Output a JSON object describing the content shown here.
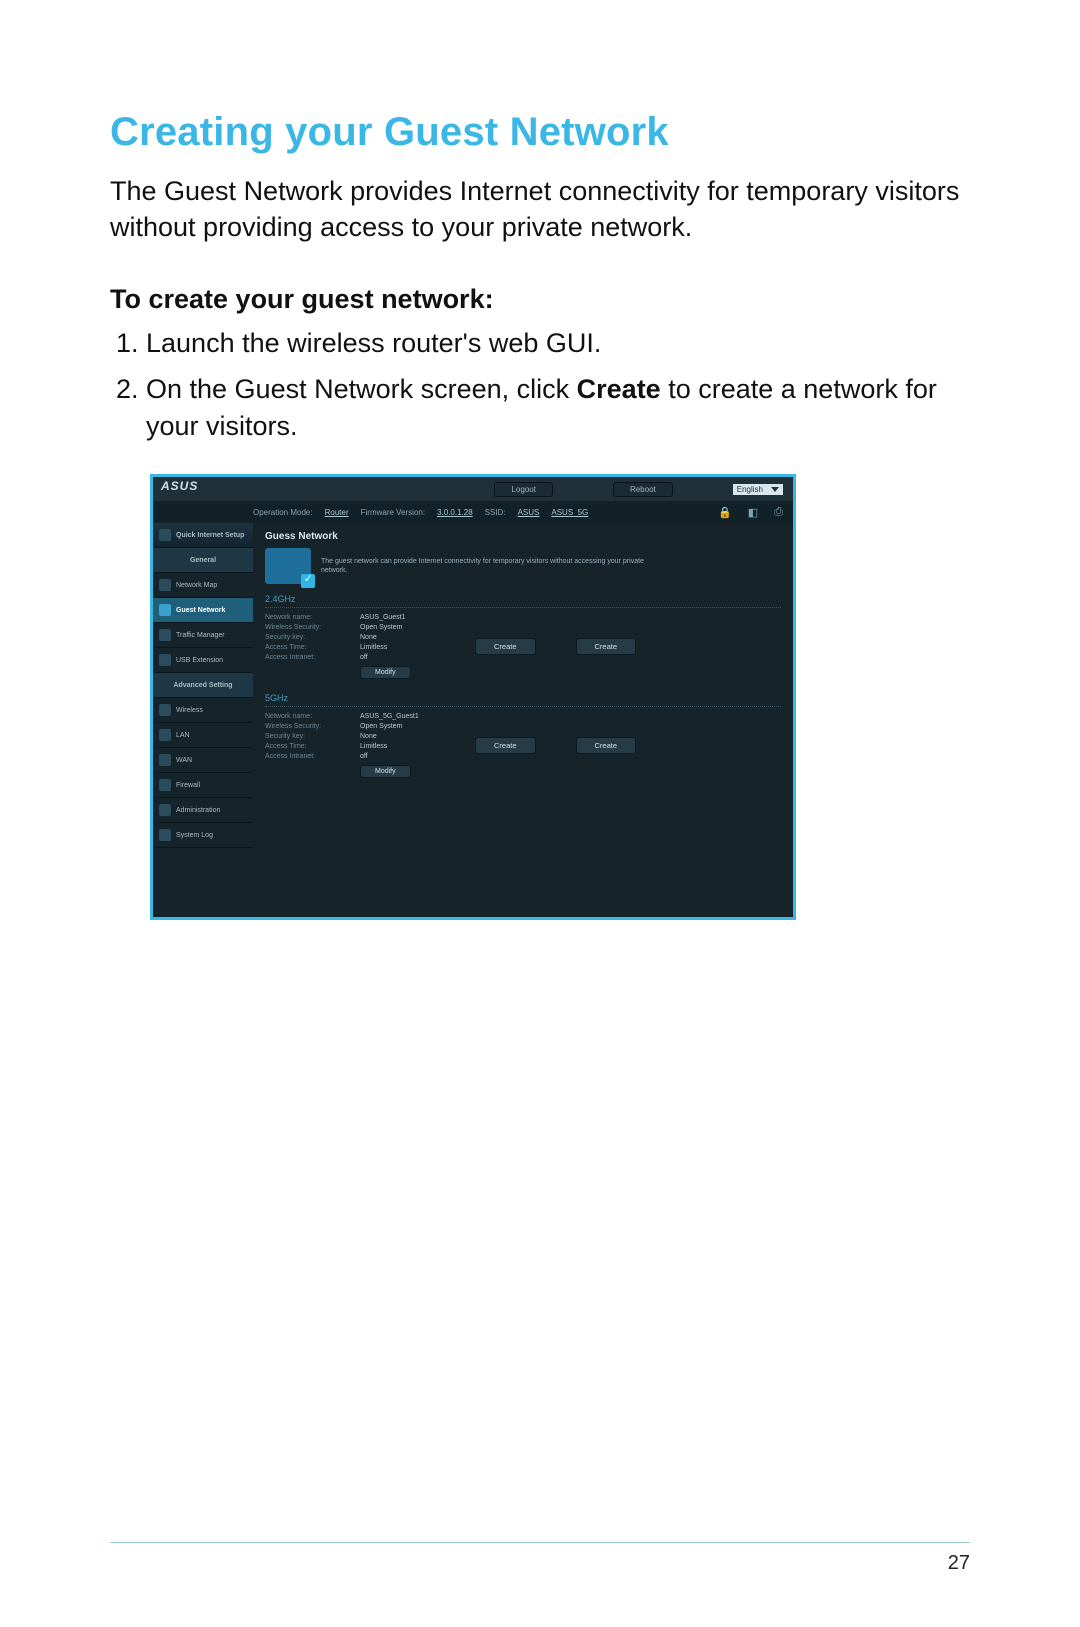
{
  "doc": {
    "heading": "Creating your Guest Network",
    "intro": "The Guest Network provides Internet connectivity for temporary visitors without providing access to your private network.",
    "subheading": "To create your guest network:",
    "step1": "Launch the wireless router's web GUI.",
    "step2_a": "On the Guest Network screen, click ",
    "step2_bold": "Create",
    "step2_b": " to create a network for your visitors.",
    "page_number": "27"
  },
  "gui": {
    "brand": "ASUS",
    "logout": "Logout",
    "reboot": "Reboot",
    "language": "English",
    "info": {
      "op_label": "Operation Mode:",
      "op_value": "Router",
      "fw_label": "Firmware Version:",
      "fw_value": "3.0.0.1.28",
      "ssid_label": "SSID:",
      "ssid1": "ASUS",
      "ssid2": "ASUS_5G"
    },
    "sidebar": {
      "qis": "Quick Internet Setup",
      "general": "General",
      "network_map": "Network Map",
      "guest_network": "Guest Network",
      "traffic_manager": "Traffic Manager",
      "usb_extension": "USB Extension",
      "advanced": "Advanced Setting",
      "wireless": "Wireless",
      "lan": "LAN",
      "wan": "WAN",
      "firewall": "Firewall",
      "administration": "Administration",
      "system_log": "System Log"
    },
    "panel": {
      "title": "Guess Network",
      "desc": "The guest network can provide Internet connectivity for temporary visitors without accessing your private network.",
      "band24": "2.4GHz",
      "band5": "5GHz",
      "labels": {
        "name": "Network name:",
        "security": "Wireless Security:",
        "key": "Security key:",
        "time": "Access Time:",
        "intranet": "Access Intranet:"
      },
      "v24": {
        "name": "ASUS_Guest1",
        "security": "Open System",
        "key": "None",
        "time": "Limitless",
        "intranet": "off"
      },
      "v5": {
        "name": "ASUS_5G_Guest1",
        "security": "Open System",
        "key": "None",
        "time": "Limitless",
        "intranet": "off"
      },
      "modify": "Modify",
      "create": "Create"
    }
  }
}
